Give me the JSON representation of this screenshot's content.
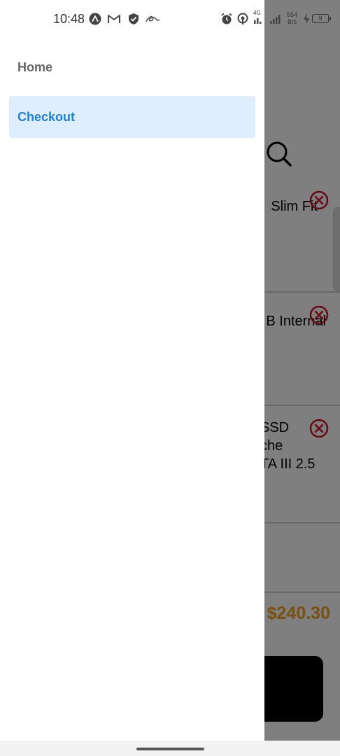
{
  "status_bar": {
    "time": "10:48",
    "net_speed_value": "554",
    "net_speed_unit": "B/s",
    "signal_label": "4G",
    "battery_level": "9"
  },
  "drawer": {
    "items": [
      {
        "label": "Home",
        "active": false
      },
      {
        "label": "Checkout",
        "active": true
      }
    ]
  },
  "background_page": {
    "items": [
      {
        "title_line1": "Slim Fit"
      },
      {
        "title_line1": "B Internal"
      },
      {
        "title_line1": "SSD",
        "title_line2": "che",
        "title_line3": "TA III 2.5"
      }
    ],
    "total": "$240.30",
    "colors": {
      "total": "#f0a020",
      "remove_icon": "#d01020",
      "drawer_active_text": "#1f7fd4",
      "drawer_active_bg": "#dfeefc"
    }
  }
}
